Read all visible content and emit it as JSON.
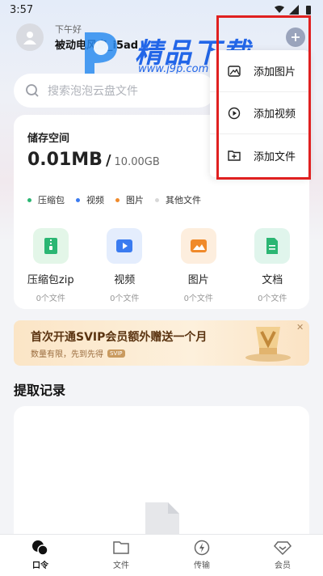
{
  "status_bar": {
    "time": "3:57"
  },
  "header": {
    "greeting": "下午好",
    "username": "被动电风扇_i5ad"
  },
  "watermark": {
    "text": "精品下载",
    "url": "www.j9p.com"
  },
  "search": {
    "placeholder": "搜索泡泡云盘文件"
  },
  "storage": {
    "title": "储存空间",
    "used": "0.01MB",
    "separator": "/",
    "total": "10.00GB",
    "legend": [
      {
        "label": "压缩包",
        "color": "#2bb673"
      },
      {
        "label": "视频",
        "color": "#3a7bf0"
      },
      {
        "label": "图片",
        "color": "#f08a2b"
      },
      {
        "label": "其他文件",
        "color": "#d8d8d8"
      }
    ]
  },
  "categories": [
    {
      "label": "压缩包zip",
      "count": "0个文件",
      "icon": "zip-icon",
      "tile": "#e3f6e8",
      "accent": "#2bb673"
    },
    {
      "label": "视频",
      "count": "0个文件",
      "icon": "video-icon",
      "tile": "#e4edfd",
      "accent": "#3a7bf0"
    },
    {
      "label": "图片",
      "count": "0个文件",
      "icon": "image-icon",
      "tile": "#fdeede",
      "accent": "#f08a2b"
    },
    {
      "label": "文档",
      "count": "0个文件",
      "icon": "document-icon",
      "tile": "#e0f5ec",
      "accent": "#2bb673"
    }
  ],
  "promo": {
    "title": "首次开通SVIP会员额外赠送一个月",
    "subtitle": "数量有限，先到先得",
    "badge": "SVIP"
  },
  "records": {
    "title": "提取记录"
  },
  "popup_menu": {
    "items": [
      {
        "label": "添加图片",
        "icon": "add-image-icon"
      },
      {
        "label": "添加视频",
        "icon": "add-video-icon"
      },
      {
        "label": "添加文件",
        "icon": "add-file-icon"
      }
    ]
  },
  "tabbar": {
    "items": [
      {
        "label": "口令",
        "icon": "passcode-icon",
        "active": true
      },
      {
        "label": "文件",
        "icon": "folder-icon",
        "active": false
      },
      {
        "label": "传输",
        "icon": "transfer-icon",
        "active": false
      },
      {
        "label": "会员",
        "icon": "vip-diamond-icon",
        "active": false
      }
    ]
  },
  "colors": {
    "accent": "#3a7bf0",
    "highlight": "#e02020",
    "promo_text": "#5a3310"
  }
}
